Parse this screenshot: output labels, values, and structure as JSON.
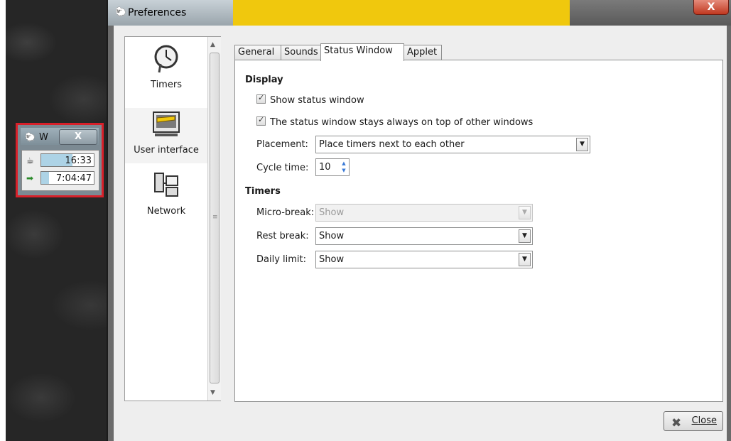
{
  "window": {
    "title": "Preferences",
    "close_glyph": "X"
  },
  "mini_window": {
    "title": "W",
    "close_glyph": "X",
    "rows": [
      {
        "icon": "coffee-cup-icon",
        "value": "16:33",
        "fill": 0.6
      },
      {
        "icon": "exit-arrow-icon",
        "value": "7:04:47",
        "fill": 0.15
      }
    ]
  },
  "nav": {
    "items": [
      {
        "label": "Timers",
        "icon": "clock-icon"
      },
      {
        "label": "User interface",
        "icon": "monitor-ruler-icon"
      },
      {
        "label": "Network",
        "icon": "network-computers-icon"
      }
    ]
  },
  "tabs": [
    {
      "label": "General"
    },
    {
      "label": "Sounds"
    },
    {
      "label": "Status Window"
    },
    {
      "label": "Applet"
    }
  ],
  "display": {
    "heading": "Display",
    "show_status": "Show status window",
    "always_on_top": "The status window stays always on top of other windows",
    "placement_label": "Placement:",
    "placement_value": "Place timers next to each other",
    "cycle_label": "Cycle time:",
    "cycle_value": "10"
  },
  "timers": {
    "heading": "Timers",
    "micro_label": "Micro-break:",
    "micro_value": "Show",
    "rest_label": "Rest break:",
    "rest_value": "Show",
    "daily_label": "Daily limit:",
    "daily_value": "Show"
  },
  "footer": {
    "close_label": "Close"
  },
  "colors": {
    "title_yellow": "#f0c80d",
    "mini_border": "#d8202a",
    "timer_fill": "#add3e6",
    "close_red": "#c03820"
  }
}
